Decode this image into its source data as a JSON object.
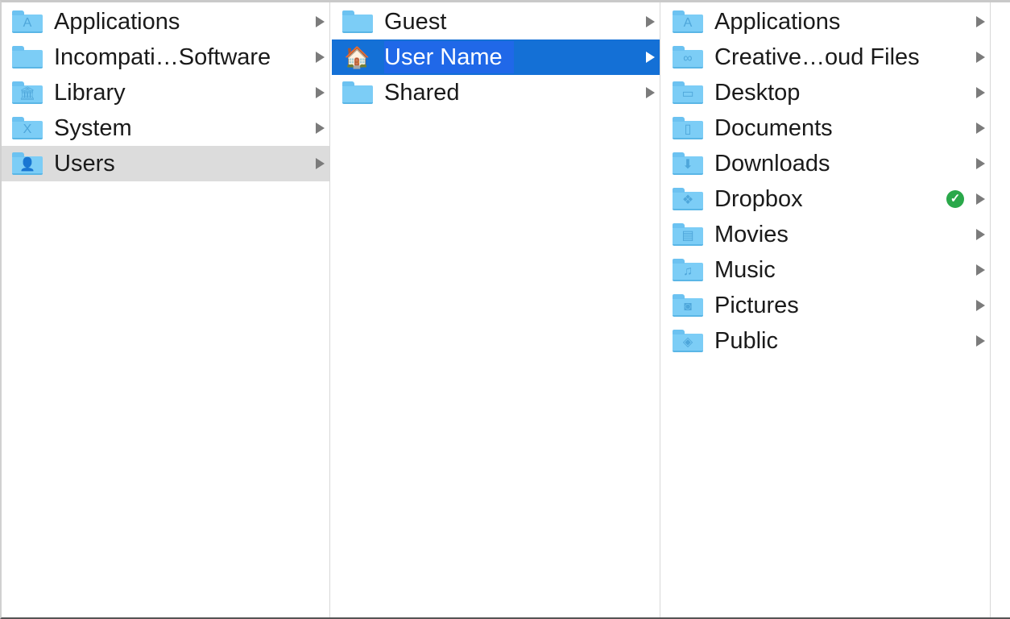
{
  "columns": [
    {
      "items": [
        {
          "label": "Applications",
          "icon": "applications-folder-icon",
          "glyph": "A"
        },
        {
          "label": "Incompati…Software",
          "icon": "folder-icon",
          "glyph": ""
        },
        {
          "label": "Library",
          "icon": "library-folder-icon",
          "glyph": "🏛"
        },
        {
          "label": "System",
          "icon": "system-folder-icon",
          "glyph": "X"
        },
        {
          "label": "Users",
          "icon": "users-folder-icon",
          "glyph": "👤",
          "selected": "gray"
        }
      ]
    },
    {
      "items": [
        {
          "label": "Guest",
          "icon": "folder-icon",
          "glyph": ""
        },
        {
          "label": "User Name",
          "icon": "home-icon",
          "glyph": "🏠",
          "selected": "blue"
        },
        {
          "label": "Shared",
          "icon": "folder-icon",
          "glyph": ""
        }
      ]
    },
    {
      "items": [
        {
          "label": "Applications",
          "icon": "applications-folder-icon",
          "glyph": "A"
        },
        {
          "label": "Creative…oud Files",
          "icon": "creative-cloud-folder-icon",
          "glyph": "∞"
        },
        {
          "label": "Desktop",
          "icon": "desktop-folder-icon",
          "glyph": "▭"
        },
        {
          "label": "Documents",
          "icon": "documents-folder-icon",
          "glyph": "▯"
        },
        {
          "label": "Downloads",
          "icon": "downloads-folder-icon",
          "glyph": "⬇"
        },
        {
          "label": "Dropbox",
          "icon": "dropbox-folder-icon",
          "glyph": "❖",
          "badge": "✓"
        },
        {
          "label": "Movies",
          "icon": "movies-folder-icon",
          "glyph": "▤"
        },
        {
          "label": "Music",
          "icon": "music-folder-icon",
          "glyph": "♫"
        },
        {
          "label": "Pictures",
          "icon": "pictures-folder-icon",
          "glyph": "◙"
        },
        {
          "label": "Public",
          "icon": "public-folder-icon",
          "glyph": "◈"
        }
      ]
    }
  ],
  "colors": {
    "selection_blue": "#1470d6",
    "selection_gray": "#dcdcdc",
    "folder": "#7ccdf6",
    "sync_badge": "#2aa84a"
  }
}
